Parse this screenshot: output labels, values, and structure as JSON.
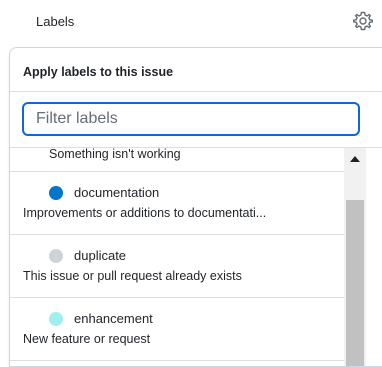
{
  "sidebar": {
    "title": "Labels",
    "settings_icon": "gear-icon"
  },
  "panel": {
    "title": "Apply labels to this issue",
    "filter": {
      "value": "",
      "placeholder": "Filter labels"
    },
    "partial_description": "Something isn't working",
    "labels": [
      {
        "name": "documentation",
        "description": "Improvements or additions to documentati...",
        "color": "#0075ca"
      },
      {
        "name": "duplicate",
        "description": "This issue or pull request already exists",
        "color": "#cfd3d7"
      },
      {
        "name": "enhancement",
        "description": "New feature or request",
        "color": "#a2eeef"
      }
    ]
  },
  "colors": {
    "accent": "#0969da"
  }
}
